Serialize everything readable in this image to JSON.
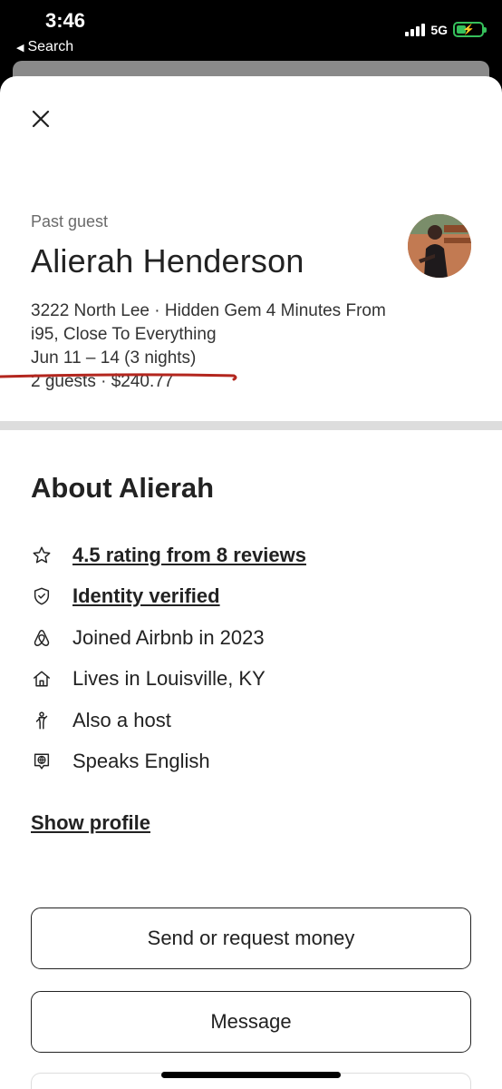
{
  "status_bar": {
    "time": "3:46",
    "back_app": "Search",
    "network": "5G",
    "battery_level": 0.4,
    "battery_color": "#36c05b"
  },
  "sheet": {
    "close_icon": "close-icon",
    "guest": {
      "label": "Past guest",
      "name": "Alierah Henderson"
    },
    "trip": {
      "listing": "3222 North Lee  · Hidden Gem 4 Minutes From i95, Close To Everything",
      "dates": "Jun 11 – 14 (3 nights)",
      "summary": "2 guests · $240.77"
    },
    "about": {
      "title": "About Alierah",
      "facts": [
        {
          "icon": "star-icon",
          "text": "4.5  rating from 8 reviews",
          "link": true
        },
        {
          "icon": "shield-check-icon",
          "text": "Identity verified",
          "link": true
        },
        {
          "icon": "airbnb-logo-icon",
          "text": "Joined Airbnb in 2023",
          "link": false
        },
        {
          "icon": "home-icon",
          "text": "Lives in Louisville, KY",
          "link": false
        },
        {
          "icon": "host-icon",
          "text": "Also a host",
          "link": false
        },
        {
          "icon": "language-icon",
          "text": "Speaks English",
          "link": false
        }
      ],
      "show_profile": "Show profile"
    },
    "buttons": {
      "send_money": "Send or request money",
      "message": "Message"
    }
  }
}
